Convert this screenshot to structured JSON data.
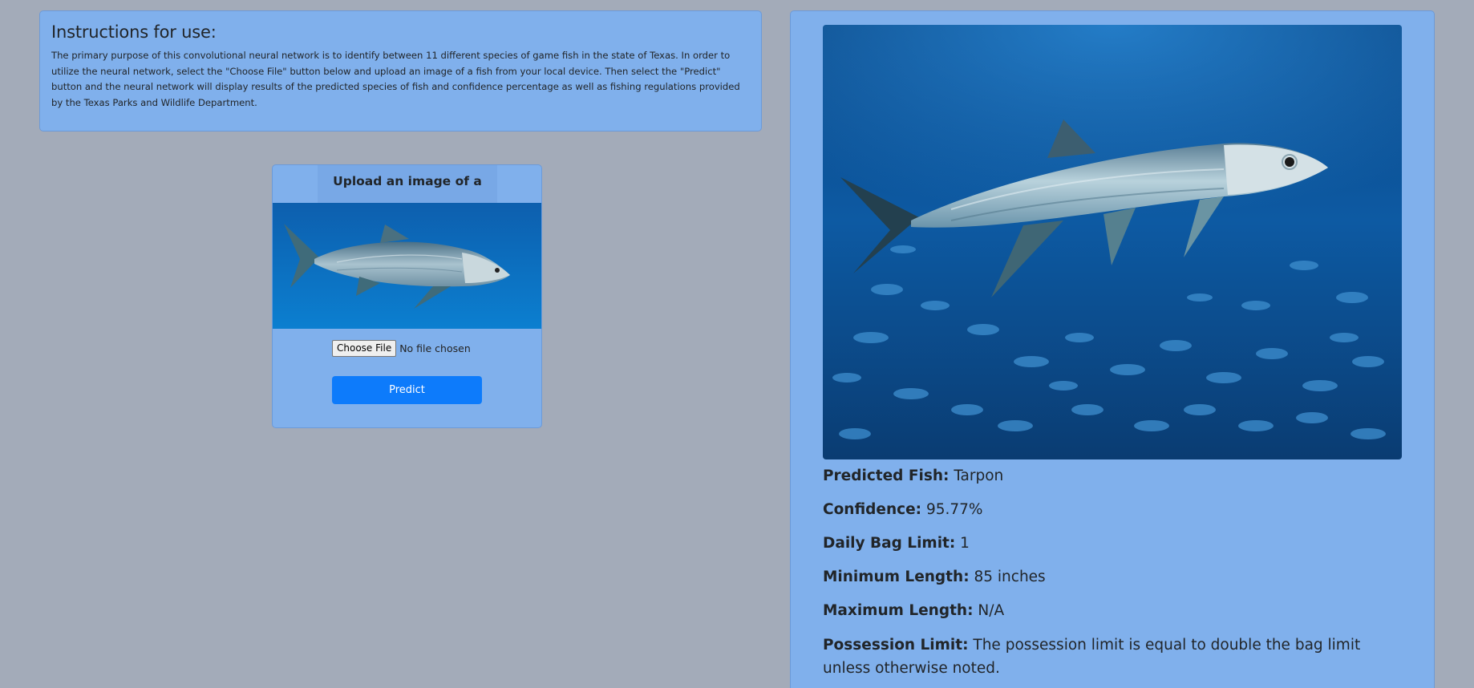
{
  "instructions": {
    "title": "Instructions for use:",
    "body": "The primary purpose of this convolutional neural network is to identify between 11 different species of game fish in the state of Texas. In order to utilize the neural network, select the \"Choose File\" button below and upload an image of a fish from your local device. Then select the \"Predict\" button and the neural network will display results of the predicted species of fish and confidence percentage as well as fishing regulations provided by the Texas Parks and Wildlife Department."
  },
  "upload": {
    "header": "Upload an image of a fish:",
    "choose_file_label": "Choose File",
    "file_status": "No file chosen",
    "predict_label": "Predict"
  },
  "result": {
    "fields": [
      {
        "label": "Predicted Fish:",
        "value": "Tarpon"
      },
      {
        "label": "Confidence:",
        "value": "95.77%"
      },
      {
        "label": "Daily Bag Limit:",
        "value": "1"
      },
      {
        "label": "Minimum Length:",
        "value": "85 inches"
      },
      {
        "label": "Maximum Length:",
        "value": "N/A"
      },
      {
        "label": "Possession Limit:",
        "value": "The possession limit is equal to double the bag limit unless otherwise noted."
      }
    ]
  },
  "colors": {
    "page_bg": "#a3abb9",
    "card_bg": "#80b0ec",
    "predict_button": "#0d7bfb",
    "water_dark": "#0a3f78",
    "water_light": "#1b76c4"
  }
}
